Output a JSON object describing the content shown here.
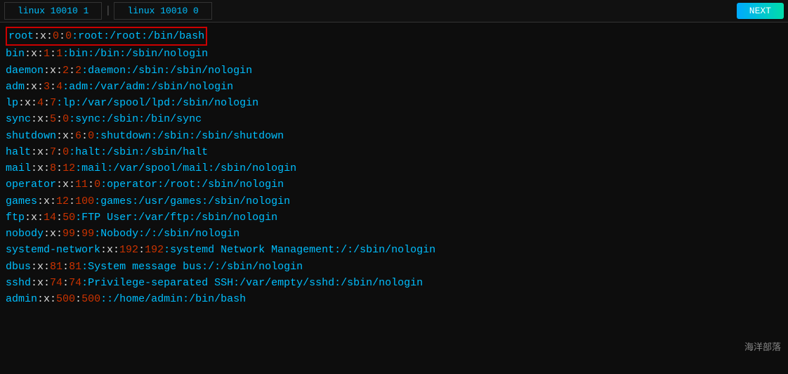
{
  "tabs": [
    {
      "label": "linux 10010 1"
    },
    {
      "label": "linux 10010 0"
    }
  ],
  "next_button": "NEXT",
  "lines": [
    {
      "id": "root-line",
      "highlighted": true,
      "parts": [
        {
          "text": "root",
          "color": "cyan"
        },
        {
          "text": ":x:",
          "color": "white"
        },
        {
          "text": "0",
          "color": "red-num"
        },
        {
          "text": ":",
          "color": "white"
        },
        {
          "text": "0",
          "color": "red-num"
        },
        {
          "text": ":root:/root:/bin/bash",
          "color": "cyan"
        }
      ]
    },
    {
      "id": "bin-line",
      "parts": [
        {
          "text": "bin",
          "color": "cyan"
        },
        {
          "text": ":x:",
          "color": "white"
        },
        {
          "text": "1",
          "color": "red-num"
        },
        {
          "text": ":",
          "color": "white"
        },
        {
          "text": "1",
          "color": "red-num"
        },
        {
          "text": ":bin:/bin:/sbin/nologin",
          "color": "cyan"
        }
      ]
    },
    {
      "id": "daemon-line",
      "parts": [
        {
          "text": "daemon",
          "color": "cyan"
        },
        {
          "text": ":x:",
          "color": "white"
        },
        {
          "text": "2",
          "color": "red-num"
        },
        {
          "text": ":",
          "color": "white"
        },
        {
          "text": "2",
          "color": "red-num"
        },
        {
          "text": ":daemon:/sbin:/sbin/nologin",
          "color": "cyan"
        }
      ]
    },
    {
      "id": "adm-line",
      "parts": [
        {
          "text": "adm",
          "color": "cyan"
        },
        {
          "text": ":x:",
          "color": "white"
        },
        {
          "text": "3",
          "color": "red-num"
        },
        {
          "text": ":",
          "color": "white"
        },
        {
          "text": "4",
          "color": "red-num"
        },
        {
          "text": ":adm:/var/adm:/sbin/nologin",
          "color": "cyan"
        }
      ]
    },
    {
      "id": "lp-line",
      "parts": [
        {
          "text": "lp",
          "color": "cyan"
        },
        {
          "text": ":x:",
          "color": "white"
        },
        {
          "text": "4",
          "color": "red-num"
        },
        {
          "text": ":",
          "color": "white"
        },
        {
          "text": "7",
          "color": "red-num"
        },
        {
          "text": ":lp:/var/spool/lpd:/sbin/nologin",
          "color": "cyan"
        }
      ]
    },
    {
      "id": "sync-line",
      "parts": [
        {
          "text": "sync",
          "color": "cyan"
        },
        {
          "text": ":x:",
          "color": "white"
        },
        {
          "text": "5",
          "color": "red-num"
        },
        {
          "text": ":",
          "color": "white"
        },
        {
          "text": "0",
          "color": "red-num"
        },
        {
          "text": ":sync:/sbin:/bin/sync",
          "color": "cyan"
        }
      ]
    },
    {
      "id": "shutdown-line",
      "parts": [
        {
          "text": "shutdown",
          "color": "cyan"
        },
        {
          "text": ":x:",
          "color": "white"
        },
        {
          "text": "6",
          "color": "red-num"
        },
        {
          "text": ":",
          "color": "white"
        },
        {
          "text": "0",
          "color": "red-num"
        },
        {
          "text": ":shutdown:/sbin:/sbin/shutdown",
          "color": "cyan"
        }
      ]
    },
    {
      "id": "halt-line",
      "parts": [
        {
          "text": "halt",
          "color": "cyan"
        },
        {
          "text": ":x:",
          "color": "white"
        },
        {
          "text": "7",
          "color": "red-num"
        },
        {
          "text": ":",
          "color": "white"
        },
        {
          "text": "0",
          "color": "red-num"
        },
        {
          "text": ":halt:/sbin:/sbin/halt",
          "color": "cyan"
        }
      ]
    },
    {
      "id": "mail-line",
      "parts": [
        {
          "text": "mail",
          "color": "cyan"
        },
        {
          "text": ":x:",
          "color": "white"
        },
        {
          "text": "8",
          "color": "red-num"
        },
        {
          "text": ":",
          "color": "white"
        },
        {
          "text": "12",
          "color": "red-num"
        },
        {
          "text": ":mail:/var/spool/mail:/sbin/nologin",
          "color": "cyan"
        }
      ]
    },
    {
      "id": "operator-line",
      "parts": [
        {
          "text": "operator",
          "color": "cyan"
        },
        {
          "text": ":x:",
          "color": "white"
        },
        {
          "text": "11",
          "color": "red-num"
        },
        {
          "text": ":",
          "color": "white"
        },
        {
          "text": "0",
          "color": "red-num"
        },
        {
          "text": ":operator:/root:/sbin/nologin",
          "color": "cyan"
        }
      ]
    },
    {
      "id": "games-line",
      "parts": [
        {
          "text": "games",
          "color": "cyan"
        },
        {
          "text": ":x:",
          "color": "white"
        },
        {
          "text": "12",
          "color": "red-num"
        },
        {
          "text": ":",
          "color": "white"
        },
        {
          "text": "100",
          "color": "red-num"
        },
        {
          "text": ":games:/usr/games:/sbin/nologin",
          "color": "cyan"
        }
      ]
    },
    {
      "id": "ftp-line",
      "parts": [
        {
          "text": "ftp",
          "color": "cyan"
        },
        {
          "text": ":x:",
          "color": "white"
        },
        {
          "text": "14",
          "color": "red-num"
        },
        {
          "text": ":",
          "color": "white"
        },
        {
          "text": "50",
          "color": "red-num"
        },
        {
          "text": ":FTP User:/var/ftp:/sbin/nologin",
          "color": "cyan"
        }
      ]
    },
    {
      "id": "nobody-line",
      "parts": [
        {
          "text": "nobody",
          "color": "cyan"
        },
        {
          "text": ":x:",
          "color": "white"
        },
        {
          "text": "99",
          "color": "red-num"
        },
        {
          "text": ":",
          "color": "white"
        },
        {
          "text": "99",
          "color": "red-num"
        },
        {
          "text": ":Nobody:/:/sbin/nologin",
          "color": "cyan"
        }
      ]
    },
    {
      "id": "systemd-network-line",
      "parts": [
        {
          "text": "systemd-network",
          "color": "cyan"
        },
        {
          "text": ":x:",
          "color": "white"
        },
        {
          "text": "192",
          "color": "red-num"
        },
        {
          "text": ":",
          "color": "white"
        },
        {
          "text": "192",
          "color": "red-num"
        },
        {
          "text": ":systemd Network Management:/:/sbin/nologin",
          "color": "cyan"
        }
      ]
    },
    {
      "id": "dbus-line",
      "parts": [
        {
          "text": "dbus",
          "color": "cyan"
        },
        {
          "text": ":x:",
          "color": "white"
        },
        {
          "text": "81",
          "color": "red-num"
        },
        {
          "text": ":",
          "color": "white"
        },
        {
          "text": "81",
          "color": "red-num"
        },
        {
          "text": ":System message bus:/:/sbin/nologin",
          "color": "cyan"
        }
      ]
    },
    {
      "id": "sshd-line",
      "parts": [
        {
          "text": "sshd",
          "color": "cyan"
        },
        {
          "text": ":x:",
          "color": "white"
        },
        {
          "text": "74",
          "color": "red-num"
        },
        {
          "text": ":",
          "color": "white"
        },
        {
          "text": "74",
          "color": "red-num"
        },
        {
          "text": ":Privilege-separated SSH:/var/empty/sshd:/sbin/nologin",
          "color": "cyan"
        }
      ]
    },
    {
      "id": "admin-line",
      "parts": [
        {
          "text": "admin",
          "color": "cyan"
        },
        {
          "text": ":x:",
          "color": "white"
        },
        {
          "text": "500",
          "color": "red-num"
        },
        {
          "text": ":",
          "color": "white"
        },
        {
          "text": "500",
          "color": "red-num"
        },
        {
          "text": "::/home/admin:/bin/bash",
          "color": "cyan"
        }
      ]
    }
  ],
  "watermark": "海洋部落"
}
